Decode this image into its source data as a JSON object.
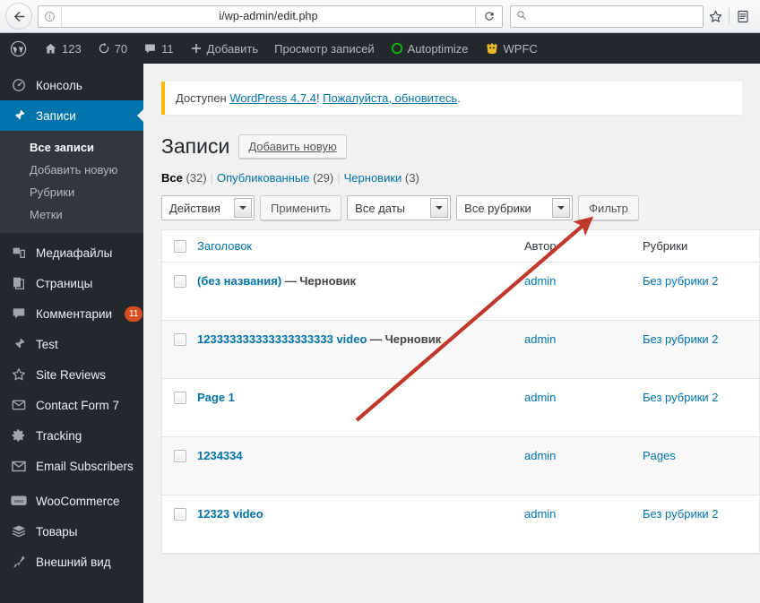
{
  "browser": {
    "back_icon": "back-arrow-icon",
    "identity_icon": "info-icon",
    "url": "i/wp-admin/edit.php",
    "reload_icon": "reload-icon",
    "search_placeholder": "",
    "search_value": "",
    "search_icon": "search-icon",
    "bookmark_icon": "star-icon",
    "reader_icon": "reader-list-icon"
  },
  "adminbar": {
    "items": [
      {
        "icon": "wordpress-logo-icon",
        "label": ""
      },
      {
        "icon": "home-icon",
        "label": "123"
      },
      {
        "icon": "update-icon",
        "label": "70"
      },
      {
        "icon": "comment-icon",
        "label": "11"
      },
      {
        "icon": "plus-icon",
        "label": "Добавить"
      },
      {
        "icon": "",
        "label": "Просмотр записей"
      },
      {
        "icon": "autoptimize-icon",
        "label": "Autoptimize"
      },
      {
        "icon": "wpfc-icon",
        "label": "WPFC"
      }
    ]
  },
  "sidebar": {
    "items": [
      {
        "icon": "dashboard-icon",
        "label": "Консоль",
        "current": false
      },
      {
        "icon": "pin-icon",
        "label": "Записи",
        "current": true
      },
      {
        "icon": "media-icon",
        "label": "Медиафайлы",
        "current": false
      },
      {
        "icon": "pages-icon",
        "label": "Страницы",
        "current": false
      },
      {
        "icon": "comments-icon",
        "label": "Комментарии",
        "current": false,
        "badge": "11"
      },
      {
        "icon": "pin-icon",
        "label": "Test",
        "current": false
      },
      {
        "icon": "star-icon",
        "label": "Site Reviews",
        "current": false
      },
      {
        "icon": "envelope-icon",
        "label": "Contact Form 7",
        "current": false
      },
      {
        "icon": "gear-icon",
        "label": "Tracking",
        "current": false
      },
      {
        "icon": "mail-icon",
        "label": "Email Subscribers",
        "current": false
      },
      {
        "icon": "woocommerce-icon",
        "label": "WooCommerce",
        "current": false
      },
      {
        "icon": "products-icon",
        "label": "Товары",
        "current": false
      },
      {
        "icon": "appearance-icon",
        "label": "Внешний вид",
        "current": false
      }
    ],
    "submenu": [
      {
        "label": "Все записи",
        "current": true
      },
      {
        "label": "Добавить новую",
        "current": false
      },
      {
        "label": "Рубрики",
        "current": false
      },
      {
        "label": "Метки",
        "current": false
      }
    ]
  },
  "notice": {
    "text_before": "Доступен ",
    "link1": "WordPress 4.7.4",
    "text_mid": "! ",
    "link2": "Пожалуйста, обновитесь",
    "text_after": "."
  },
  "page": {
    "title": "Записи",
    "add_new_label": "Добавить новую"
  },
  "status_links": [
    {
      "label": "Все",
      "count": "(32)",
      "current": true
    },
    {
      "label": "Опубликованные",
      "count": "(29)",
      "current": false
    },
    {
      "label": "Черновики",
      "count": "(3)",
      "current": false
    }
  ],
  "toolbar": {
    "bulk_actions_value": "Действия",
    "apply_label": "Применить",
    "dates_value": "Все даты",
    "categories_value": "Все рубрики",
    "filter_label": "Фильтр"
  },
  "table": {
    "columns": {
      "title": "Заголовок",
      "author": "Автор",
      "categories": "Рубрики"
    },
    "rows": [
      {
        "title": "(без названия)",
        "state": " — Черновик",
        "author": "admin",
        "categories": "Без рубрики 2"
      },
      {
        "title": "123333333333333333333 video",
        "state": " — Черновик",
        "author": "admin",
        "categories": "Без рубрики 2"
      },
      {
        "title": "Page 1",
        "state": "",
        "author": "admin",
        "categories": "Без рубрики 2"
      },
      {
        "title": "1234334",
        "state": "",
        "author": "admin",
        "categories": "Pages"
      },
      {
        "title": "12323 video",
        "state": "",
        "author": "admin",
        "categories": "Без рубрики 2"
      }
    ]
  },
  "annotation": {
    "arrow_color": "#c0392b",
    "arrow_points_to": "Фильтр"
  },
  "colors": {
    "admin_dark": "#23282d",
    "admin_submenu": "#32373c",
    "accent_blue": "#0073aa",
    "link_blue": "#0073aa",
    "notice_yellow": "#ffb900",
    "badge_orange": "#d54e21",
    "page_bg": "#f1f1f1"
  }
}
